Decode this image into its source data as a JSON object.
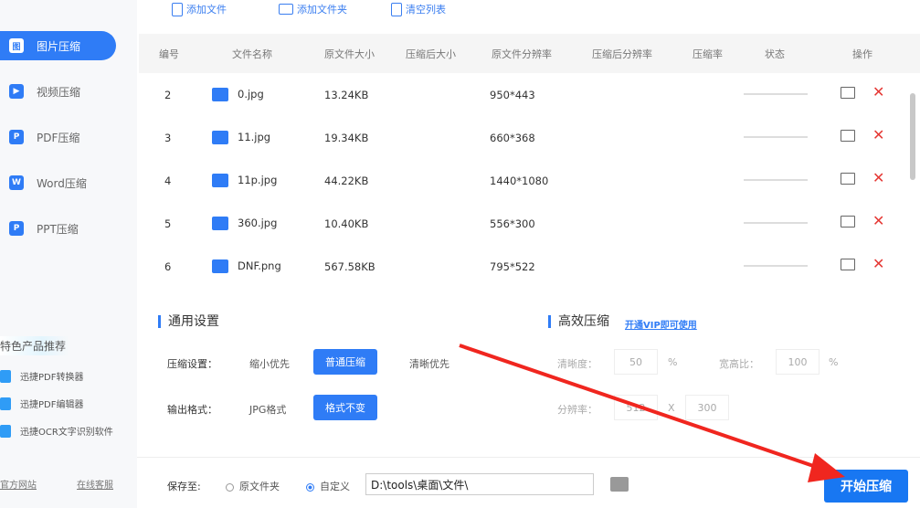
{
  "sidebar": {
    "items": [
      {
        "label": "图片压缩",
        "icon": "image"
      },
      {
        "label": "视频压缩",
        "icon": "video"
      },
      {
        "label": "PDF压缩",
        "icon": "pdf"
      },
      {
        "label": "Word压缩",
        "icon": "word"
      },
      {
        "label": "PPT压缩",
        "icon": "ppt"
      }
    ],
    "recommend_title": "特色产品推荐",
    "recommend": [
      "迅捷PDF转换器",
      "迅捷PDF编辑器",
      "迅捷OCR文字识别软件"
    ],
    "official_site": "官方网站",
    "online_service": "在线客服"
  },
  "toolbar": {
    "add_file": "添加文件",
    "add_folder": "添加文件夹",
    "clear_list": "清空列表"
  },
  "table": {
    "headers": [
      "编号",
      "文件名称",
      "原文件大小",
      "压缩后大小",
      "原文件分辨率",
      "压缩后分辨率",
      "压缩率",
      "状态",
      "操作"
    ],
    "rows": [
      {
        "no": "2",
        "name": "0.jpg",
        "size": "13.24KB",
        "res": "950*443"
      },
      {
        "no": "3",
        "name": "11.jpg",
        "size": "19.34KB",
        "res": "660*368"
      },
      {
        "no": "4",
        "name": "11p.jpg",
        "size": "44.22KB",
        "res": "1440*1080"
      },
      {
        "no": "5",
        "name": "360.jpg",
        "size": "10.40KB",
        "res": "556*300"
      },
      {
        "no": "6",
        "name": "DNF.png",
        "size": "567.58KB",
        "res": "795*522"
      }
    ]
  },
  "settings": {
    "general_title": "通用设置",
    "compress_label": "压缩设置：",
    "compress_opts": [
      "缩小优先",
      "普通压缩",
      "清晰优先"
    ],
    "format_label": "输出格式：",
    "format_opts": [
      "JPG格式",
      "格式不变"
    ],
    "efficient_title": "高效压缩",
    "vip_link": "开通VIP即可使用",
    "clarity_label": "清晰度：",
    "clarity": "50",
    "pct": "%",
    "ratio_label": "宽高比：",
    "ratio": "100",
    "res_label": "分辨率：",
    "res_w": "512",
    "x": "X",
    "res_h": "300"
  },
  "bottom": {
    "save_label": "保存至:",
    "orig_folder": "原文件夹",
    "custom": "自定义",
    "path": "D:\\tools\\桌面\\文件\\",
    "start": "开始压缩"
  },
  "colors": {
    "accent": "#2f7cf6",
    "arrow": "#f0261f"
  }
}
